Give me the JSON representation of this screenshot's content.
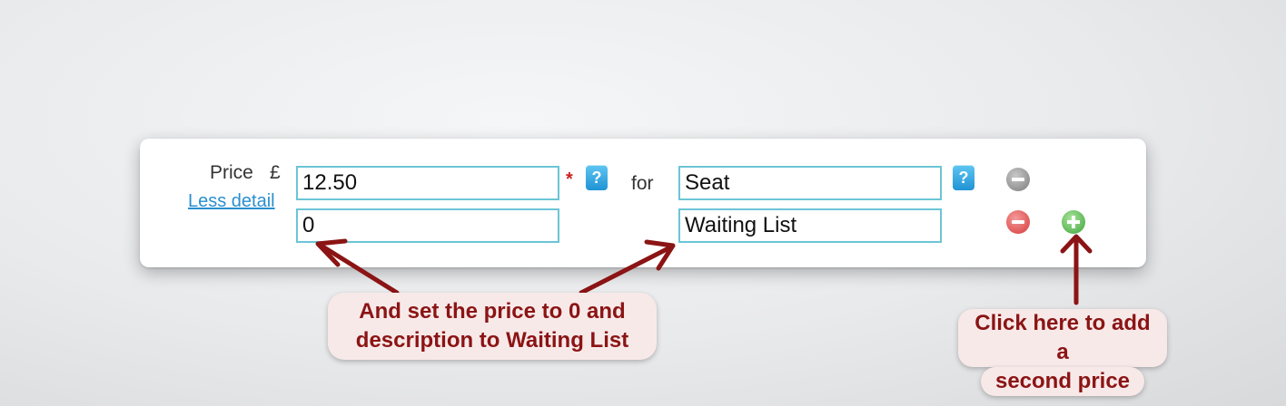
{
  "form": {
    "price_label": "Price",
    "currency_symbol": "£",
    "less_detail_link": "Less detail",
    "required_marker": "*",
    "help_icon_glyph": "?",
    "for_label": "for",
    "rows": [
      {
        "price": "12.50",
        "description": "Seat"
      },
      {
        "price": "0",
        "description": "Waiting List"
      }
    ]
  },
  "annotations": {
    "set_price_callout": "And set the price to 0 and description to Waiting List",
    "add_price_callout_line1": "Click here to add a",
    "add_price_callout_line2": "second price"
  },
  "colors": {
    "arrow": "#8b1414",
    "field_border": "#6cc5d6",
    "link": "#2a8fd0",
    "callout_text": "#8b1414"
  },
  "icons": {
    "help": "question-icon",
    "remove_disabled": "minus-circle-icon",
    "remove": "minus-circle-icon",
    "add": "plus-circle-icon"
  }
}
